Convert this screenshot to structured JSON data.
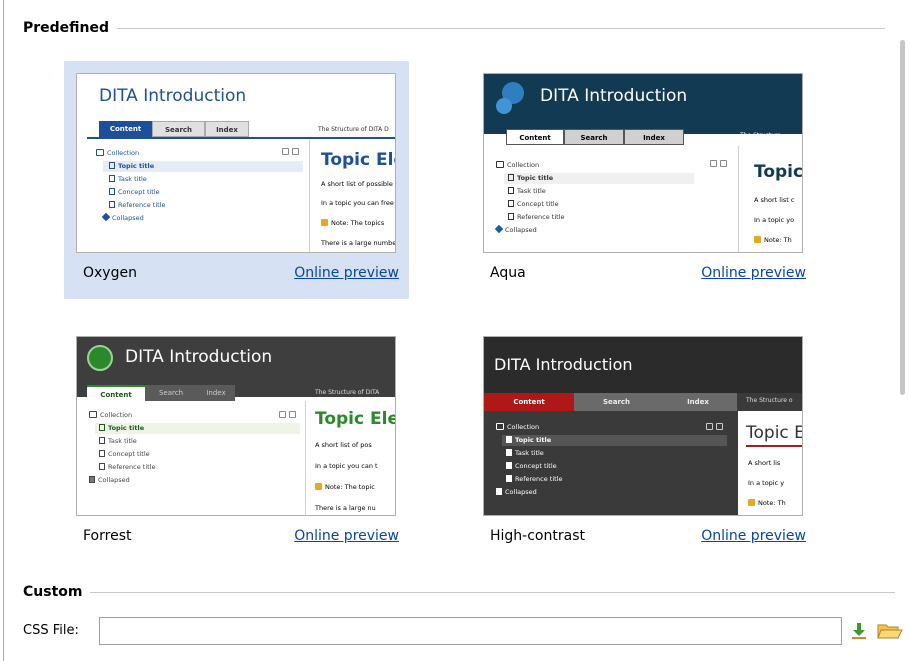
{
  "predefined": {
    "title": "Predefined",
    "skins": [
      {
        "name": "Oxygen",
        "link": "Online preview",
        "selected": true,
        "thumb": {
          "title": "DITA Introduction",
          "tabs": [
            "Content",
            "Search",
            "Index"
          ],
          "structure_text": "The Structure of DITA D",
          "tree": [
            "Collection",
            "Topic title",
            "Task title",
            "Concept title",
            "Reference title",
            "Collapsed"
          ],
          "topic": "Topic Elem",
          "lines": [
            "A short list of possible",
            "In a topic you can free",
            "Note: The topics",
            "There is a large numbe"
          ]
        }
      },
      {
        "name": "Aqua",
        "link": "Online preview",
        "selected": false,
        "thumb": {
          "title": "DITA Introduction",
          "tabs": [
            "Content",
            "Search",
            "Index"
          ],
          "structure_text": "The Structure",
          "tree": [
            "Collection",
            "Topic title",
            "Task title",
            "Concept title",
            "Reference title",
            "Collapsed"
          ],
          "topic": "Topic",
          "lines": [
            "A short list c",
            "In a topic yo",
            "Note: Th"
          ]
        }
      },
      {
        "name": "Forrest",
        "link": "Online preview",
        "selected": false,
        "thumb": {
          "title": "DITA Introduction",
          "tabs": [
            "Content",
            "Search",
            "Index"
          ],
          "structure_text": "The Structure of DITA",
          "tree": [
            "Collection",
            "Topic title",
            "Task title",
            "Concept title",
            "Reference title",
            "Collapsed"
          ],
          "topic": "Topic Ele",
          "lines": [
            "A short list of pos",
            "In a topic you can t",
            "Note: The topic",
            "There is a large nu"
          ]
        }
      },
      {
        "name": "High-contrast",
        "link": "Online preview",
        "selected": false,
        "thumb": {
          "title": "DITA Introduction",
          "tabs": [
            "Content",
            "Search",
            "Index"
          ],
          "structure_text": "The Structure o",
          "tree": [
            "Collection",
            "Topic title",
            "Task title",
            "Concept title",
            "Reference title",
            "Collapsed"
          ],
          "topic": "Topic E",
          "lines": [
            "A short lis",
            "In a topic y",
            "Note: Th"
          ]
        }
      }
    ]
  },
  "custom": {
    "title": "Custom",
    "css_label": "CSS File:",
    "css_value": "",
    "download_icon": "download-icon",
    "browse_icon": "folder-open-icon"
  },
  "colors": {
    "selection": "#d6e1f3",
    "link": "#0645ad",
    "oxygen_blue": "#1d4f9a",
    "aqua_dark": "#123a52",
    "forrest_dark": "#3e3e3e",
    "forrest_green": "#2a8a2a",
    "hc_red": "#b01818",
    "hc_dark": "#3a3a3a"
  }
}
